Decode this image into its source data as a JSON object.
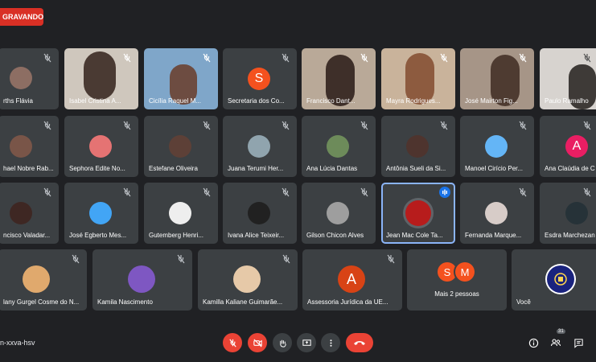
{
  "recording": {
    "label": "GRAVANDO"
  },
  "meeting_code": "n-xxva-hsv",
  "participants_count": "31",
  "colors": {
    "bg": "#202124",
    "tile": "#3c4043",
    "red": "#ea4335",
    "accent": "#8ab4f8"
  },
  "tiles": [
    {
      "name": "rths Flávia"
    },
    {
      "name": "Isabel Cristina A..."
    },
    {
      "name": "Cicília Raquel M..."
    },
    {
      "name": "Secretaria dos Co...",
      "initial": "S"
    },
    {
      "name": "Francisco Dant..."
    },
    {
      "name": "Mayra Rodrigues..."
    },
    {
      "name": "José Mairton Fig..."
    },
    {
      "name": "Paulo Ramalho"
    },
    {
      "name": "hael Nobre Rab..."
    },
    {
      "name": "Sephora Edite No..."
    },
    {
      "name": "Estefane Oliveira"
    },
    {
      "name": "Juana Terumi Her..."
    },
    {
      "name": "Ana Lúcia Dantas"
    },
    {
      "name": "Antônia Sueli da Si..."
    },
    {
      "name": "Manoel Cirício Per..."
    },
    {
      "name": "Ana Claúdia de C",
      "initial": "A"
    },
    {
      "name": "ncisco Valadar..."
    },
    {
      "name": "José Egberto Mes..."
    },
    {
      "name": "Gutemberg Henri..."
    },
    {
      "name": "Ivana Alice Teixeir..."
    },
    {
      "name": "Gilson Chicon Alves"
    },
    {
      "name": "Jean Mac Cole Ta..."
    },
    {
      "name": "Fernanda Marque..."
    },
    {
      "name": "Esdra Marchezan"
    },
    {
      "name": "lany Gurgel Cosme do N..."
    },
    {
      "name": "Kamila Nascimento"
    },
    {
      "name": "Kamilla Kaliane Guimarãe..."
    },
    {
      "name": "Assessoria Jurídica da UE...",
      "initial": "A"
    },
    {
      "name": "Mais 2 pessoas",
      "initials": [
        "S",
        "M"
      ]
    },
    {
      "name": "Você"
    }
  ],
  "controls": {
    "mic": "mic-off-icon",
    "camera": "camera-off-icon",
    "hand": "raise-hand-icon",
    "present": "present-screen-icon",
    "more": "more-options-icon",
    "end": "end-call-icon",
    "info": "info-icon",
    "people": "people-icon",
    "chat": "chat-icon"
  }
}
